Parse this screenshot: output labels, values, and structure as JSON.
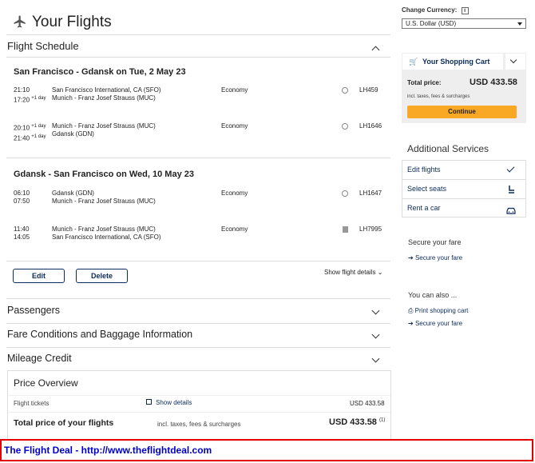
{
  "header": {
    "title": "Your Flights"
  },
  "schedule": {
    "title": "Flight Schedule",
    "outbound": {
      "title": "San Francisco - Gdansk on Tue, 2 May 23",
      "legs": [
        {
          "dep_time": "21:10",
          "arr_time": "17:20",
          "arr_note": "+1 day",
          "from": "San Francisco International, CA (SFO)",
          "to": "Munich - Franz Josef Strauss (MUC)",
          "cabin": "Economy",
          "flight": "LH459"
        },
        {
          "dep_time": "20:10",
          "dep_note": "+1 day",
          "arr_time": "21:40",
          "arr_note": "+1 day",
          "from": "Munich - Franz Josef Strauss (MUC)",
          "to": "Gdansk (GDN)",
          "cabin": "Economy",
          "flight": "LH1646"
        }
      ]
    },
    "inbound": {
      "title": "Gdansk - San Francisco on Wed, 10 May 23",
      "legs": [
        {
          "dep_time": "06:10",
          "arr_time": "07:50",
          "from": "Gdansk (GDN)",
          "to": "Munich - Franz Josef Strauss (MUC)",
          "cabin": "Economy",
          "flight": "LH1647"
        },
        {
          "dep_time": "11:40",
          "arr_time": "14:05",
          "from": "Munich - Franz Josef Strauss (MUC)",
          "to": "San Francisco International, CA (SFO)",
          "cabin": "Economy",
          "flight": "LH7995"
        }
      ]
    },
    "edit_label": "Edit",
    "delete_label": "Delete",
    "show_details_label": "Show flight details"
  },
  "sections": {
    "passengers": "Passengers",
    "fare_conditions": "Fare Conditions and Baggage Information",
    "mileage": "Mileage Credit"
  },
  "price_overview": {
    "title": "Price Overview",
    "tickets_label": "Flight tickets",
    "show_details": "Show details",
    "tickets_amount": "USD 433.58",
    "total_label": "Total price of your flights",
    "total_note": "incl. taxes, fees & surcharges",
    "total_amount": "USD 433.58",
    "footnote": "(1)"
  },
  "currency": {
    "label": "Change Currency:",
    "info": "i",
    "selected": "U.S. Dollar (USD)"
  },
  "cart": {
    "title": "Your Shopping Cart",
    "total_label": "Total price:",
    "total_amount": "USD 433.58",
    "total_note": "incl. taxes, fees & surcharges",
    "continue_label": "Continue"
  },
  "services": {
    "title": "Additional Services",
    "items": [
      "Edit flights",
      "Select seats",
      "Rent a car"
    ]
  },
  "secure": {
    "title": "Secure your fare",
    "link": "Secure your fare"
  },
  "also": {
    "title": "You can also ...",
    "print": "Print shopping cart",
    "secure": "Secure your fare"
  },
  "banner": {
    "text": "The Flight Deal - http://www.theflightdeal.com"
  },
  "colors": {
    "accent": "#f9a825",
    "navy": "#0b2b5a",
    "banner_border": "#e00000",
    "banner_text": "#0000cc"
  }
}
